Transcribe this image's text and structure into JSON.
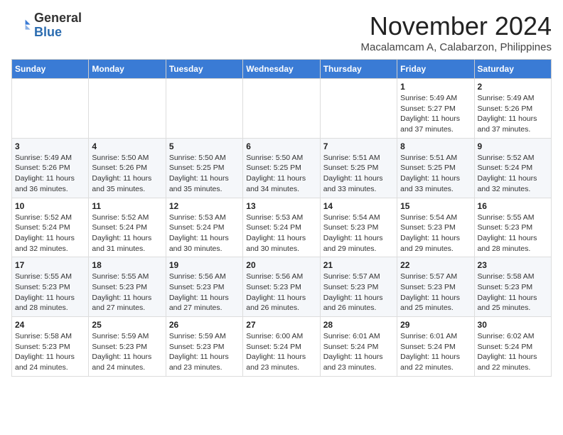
{
  "logo": {
    "general": "General",
    "blue": "Blue"
  },
  "header": {
    "month": "November 2024",
    "location": "Macalamcam A, Calabarzon, Philippines"
  },
  "weekdays": [
    "Sunday",
    "Monday",
    "Tuesday",
    "Wednesday",
    "Thursday",
    "Friday",
    "Saturday"
  ],
  "weeks": [
    [
      {
        "day": "",
        "info": ""
      },
      {
        "day": "",
        "info": ""
      },
      {
        "day": "",
        "info": ""
      },
      {
        "day": "",
        "info": ""
      },
      {
        "day": "",
        "info": ""
      },
      {
        "day": "1",
        "info": "Sunrise: 5:49 AM\nSunset: 5:27 PM\nDaylight: 11 hours\nand 37 minutes."
      },
      {
        "day": "2",
        "info": "Sunrise: 5:49 AM\nSunset: 5:26 PM\nDaylight: 11 hours\nand 37 minutes."
      }
    ],
    [
      {
        "day": "3",
        "info": "Sunrise: 5:49 AM\nSunset: 5:26 PM\nDaylight: 11 hours\nand 36 minutes."
      },
      {
        "day": "4",
        "info": "Sunrise: 5:50 AM\nSunset: 5:26 PM\nDaylight: 11 hours\nand 35 minutes."
      },
      {
        "day": "5",
        "info": "Sunrise: 5:50 AM\nSunset: 5:25 PM\nDaylight: 11 hours\nand 35 minutes."
      },
      {
        "day": "6",
        "info": "Sunrise: 5:50 AM\nSunset: 5:25 PM\nDaylight: 11 hours\nand 34 minutes."
      },
      {
        "day": "7",
        "info": "Sunrise: 5:51 AM\nSunset: 5:25 PM\nDaylight: 11 hours\nand 33 minutes."
      },
      {
        "day": "8",
        "info": "Sunrise: 5:51 AM\nSunset: 5:25 PM\nDaylight: 11 hours\nand 33 minutes."
      },
      {
        "day": "9",
        "info": "Sunrise: 5:52 AM\nSunset: 5:24 PM\nDaylight: 11 hours\nand 32 minutes."
      }
    ],
    [
      {
        "day": "10",
        "info": "Sunrise: 5:52 AM\nSunset: 5:24 PM\nDaylight: 11 hours\nand 32 minutes."
      },
      {
        "day": "11",
        "info": "Sunrise: 5:52 AM\nSunset: 5:24 PM\nDaylight: 11 hours\nand 31 minutes."
      },
      {
        "day": "12",
        "info": "Sunrise: 5:53 AM\nSunset: 5:24 PM\nDaylight: 11 hours\nand 30 minutes."
      },
      {
        "day": "13",
        "info": "Sunrise: 5:53 AM\nSunset: 5:24 PM\nDaylight: 11 hours\nand 30 minutes."
      },
      {
        "day": "14",
        "info": "Sunrise: 5:54 AM\nSunset: 5:23 PM\nDaylight: 11 hours\nand 29 minutes."
      },
      {
        "day": "15",
        "info": "Sunrise: 5:54 AM\nSunset: 5:23 PM\nDaylight: 11 hours\nand 29 minutes."
      },
      {
        "day": "16",
        "info": "Sunrise: 5:55 AM\nSunset: 5:23 PM\nDaylight: 11 hours\nand 28 minutes."
      }
    ],
    [
      {
        "day": "17",
        "info": "Sunrise: 5:55 AM\nSunset: 5:23 PM\nDaylight: 11 hours\nand 28 minutes."
      },
      {
        "day": "18",
        "info": "Sunrise: 5:55 AM\nSunset: 5:23 PM\nDaylight: 11 hours\nand 27 minutes."
      },
      {
        "day": "19",
        "info": "Sunrise: 5:56 AM\nSunset: 5:23 PM\nDaylight: 11 hours\nand 27 minutes."
      },
      {
        "day": "20",
        "info": "Sunrise: 5:56 AM\nSunset: 5:23 PM\nDaylight: 11 hours\nand 26 minutes."
      },
      {
        "day": "21",
        "info": "Sunrise: 5:57 AM\nSunset: 5:23 PM\nDaylight: 11 hours\nand 26 minutes."
      },
      {
        "day": "22",
        "info": "Sunrise: 5:57 AM\nSunset: 5:23 PM\nDaylight: 11 hours\nand 25 minutes."
      },
      {
        "day": "23",
        "info": "Sunrise: 5:58 AM\nSunset: 5:23 PM\nDaylight: 11 hours\nand 25 minutes."
      }
    ],
    [
      {
        "day": "24",
        "info": "Sunrise: 5:58 AM\nSunset: 5:23 PM\nDaylight: 11 hours\nand 24 minutes."
      },
      {
        "day": "25",
        "info": "Sunrise: 5:59 AM\nSunset: 5:23 PM\nDaylight: 11 hours\nand 24 minutes."
      },
      {
        "day": "26",
        "info": "Sunrise: 5:59 AM\nSunset: 5:23 PM\nDaylight: 11 hours\nand 23 minutes."
      },
      {
        "day": "27",
        "info": "Sunrise: 6:00 AM\nSunset: 5:24 PM\nDaylight: 11 hours\nand 23 minutes."
      },
      {
        "day": "28",
        "info": "Sunrise: 6:01 AM\nSunset: 5:24 PM\nDaylight: 11 hours\nand 23 minutes."
      },
      {
        "day": "29",
        "info": "Sunrise: 6:01 AM\nSunset: 5:24 PM\nDaylight: 11 hours\nand 22 minutes."
      },
      {
        "day": "30",
        "info": "Sunrise: 6:02 AM\nSunset: 5:24 PM\nDaylight: 11 hours\nand 22 minutes."
      }
    ]
  ]
}
